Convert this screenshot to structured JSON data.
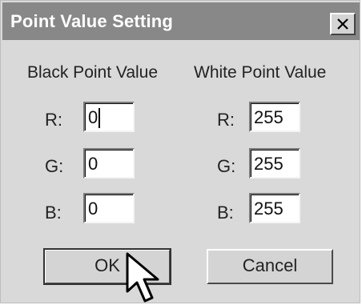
{
  "window": {
    "title": "Point Value Setting",
    "close_icon": "close-icon"
  },
  "black_point": {
    "heading": "Black Point Value",
    "channels": [
      {
        "label": "R:",
        "value": "0"
      },
      {
        "label": "G:",
        "value": "0"
      },
      {
        "label": "B:",
        "value": "0"
      }
    ]
  },
  "white_point": {
    "heading": "White Point Value",
    "channels": [
      {
        "label": "R:",
        "value": "255"
      },
      {
        "label": "G:",
        "value": "255"
      },
      {
        "label": "B:",
        "value": "255"
      }
    ]
  },
  "buttons": {
    "ok": "OK",
    "cancel": "Cancel"
  },
  "colors": {
    "titlebar": "#888888",
    "dialog_bg": "#d9d9d9",
    "field_bg": "#ffffff"
  },
  "cursor_icon": "mouse-pointer-icon"
}
